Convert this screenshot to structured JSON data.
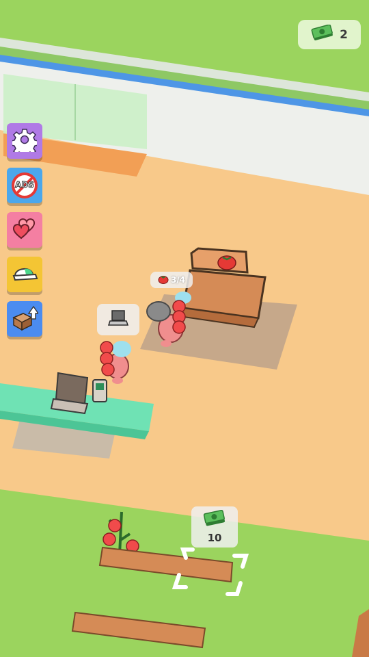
{
  "hud": {
    "money": "2",
    "money_icon": "cash-stack-icon"
  },
  "side_menu": [
    {
      "id": "settings",
      "icon": "gear-icon",
      "color": "#b07ae6"
    },
    {
      "id": "no-ads",
      "icon": "no-ads-icon",
      "label": "ADS",
      "color": "#4ba7ec"
    },
    {
      "id": "hearts",
      "icon": "hearts-icon",
      "color": "#f47fa2"
    },
    {
      "id": "cap",
      "icon": "cap-icon",
      "color": "#f4c534"
    },
    {
      "id": "upgrade-box",
      "icon": "box-upload-icon",
      "color": "#4b8cf0"
    }
  ],
  "world": {
    "cashier_bubble_icon": "laptop-icon",
    "player_carry": "3/4",
    "player_carry_icon": "tomato-icon",
    "shelf_sign_icon": "tomato-icon",
    "unlock_price": "10",
    "unlock_price_icon": "cash-stack-icon"
  },
  "colors": {
    "grass": "#9bd45e",
    "floor": "#f8c98a",
    "counter": "#6fe2b4",
    "wood": "#d58b56"
  }
}
